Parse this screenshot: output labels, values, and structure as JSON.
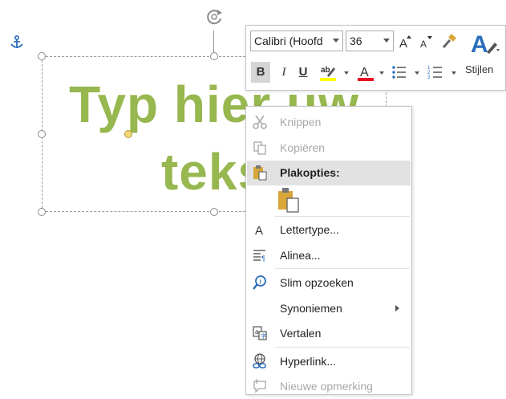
{
  "textbox": {
    "line1": "Typ hier uw",
    "line2": "teks"
  },
  "toolbar": {
    "font_name": "Calibri (Hoofd",
    "font_size": "36",
    "bold": "B",
    "italic": "I",
    "underline": "U",
    "styles_label": "Stijlen"
  },
  "context_menu": {
    "cut": "Knippen",
    "copy": "Kopiëren",
    "paste_options": "Plakopties:",
    "font": "Lettertype...",
    "paragraph": "Alinea...",
    "smart_lookup": "Slim opzoeken",
    "synonyms": "Synoniemen",
    "translate": "Vertalen",
    "hyperlink": "Hyperlink...",
    "new_comment": "Nieuwe opmerking"
  },
  "colors": {
    "text_green": "#97b74f",
    "highlight_yellow": "#ffff00",
    "font_red": "#e81123",
    "icon_blue": "#2a6ebb"
  }
}
